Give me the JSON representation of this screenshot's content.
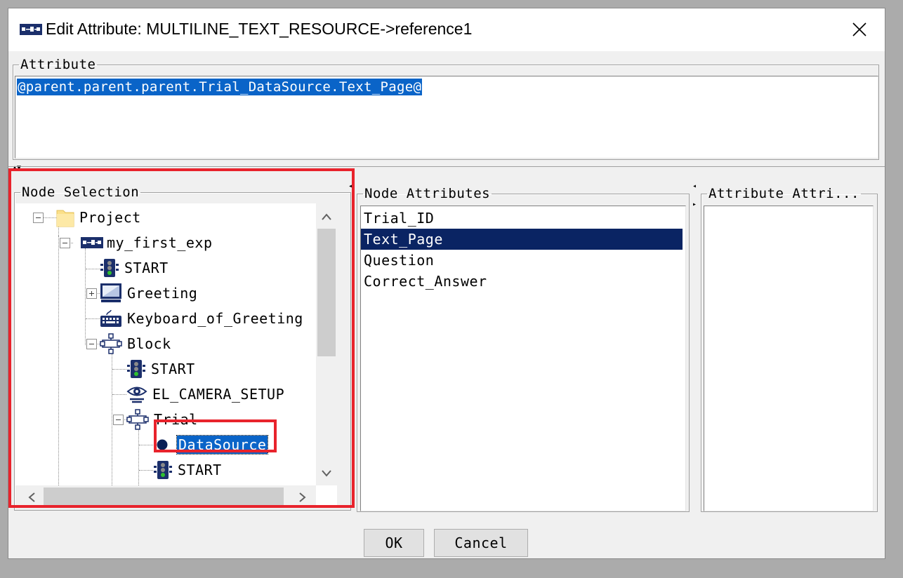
{
  "window": {
    "title": "Edit Attribute: MULTILINE_TEXT_RESOURCE->reference1",
    "title_icon": "experiment-icon",
    "close_icon": "close-icon"
  },
  "attribute_panel": {
    "legend": "Attribute",
    "value": "@parent.parent.parent.Trial_DataSource.Text_Page@"
  },
  "node_selection": {
    "legend": "Node Selection",
    "tree": [
      {
        "label": "Project",
        "icon": "folder-icon",
        "expander": "minus"
      },
      {
        "label": "my_first_exp",
        "icon": "experiment-icon",
        "expander": "minus"
      },
      {
        "label": "START",
        "icon": "traffic-light-icon"
      },
      {
        "label": "Greeting",
        "icon": "display-screen-icon",
        "expander": "plus"
      },
      {
        "label": "Keyboard_of_Greeting",
        "icon": "keyboard-icon"
      },
      {
        "label": "Block",
        "icon": "sequence-icon",
        "expander": "minus"
      },
      {
        "label": "START",
        "icon": "traffic-light-icon"
      },
      {
        "label": "EL_CAMERA_SETUP",
        "icon": "eye-camera-icon"
      },
      {
        "label": "Trial",
        "icon": "sequence-icon",
        "expander": "minus"
      },
      {
        "label": "DataSource",
        "icon": "datasource-dot-icon",
        "selected": true
      },
      {
        "label": "START",
        "icon": "traffic-light-icon"
      }
    ]
  },
  "node_attributes": {
    "legend": "Node Attributes",
    "items": [
      "Trial_ID",
      "Text_Page",
      "Question",
      "Correct_Answer"
    ],
    "selected": "Text_Page"
  },
  "attribute_attributes": {
    "legend": "Attribute Attri..."
  },
  "buttons": {
    "ok": "OK",
    "cancel": "Cancel"
  },
  "colors": {
    "selection_blue": "#0a64c8",
    "list_selection_navy": "#0a2463",
    "highlight_red": "#e8232c"
  }
}
